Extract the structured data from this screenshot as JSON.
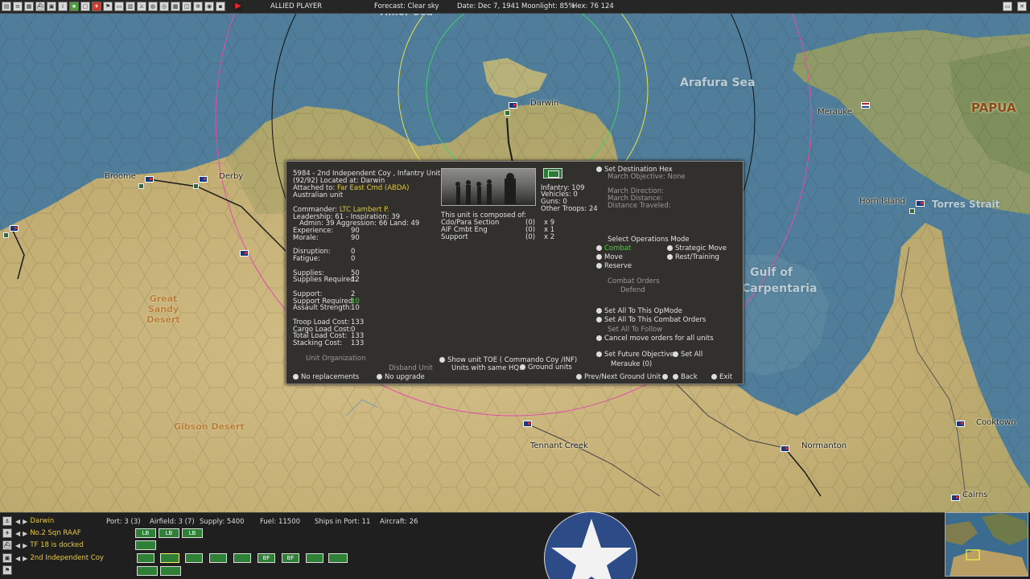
{
  "top_bar": {
    "side": "ALLIED PLAYER",
    "forecast": "Forecast: Clear sky",
    "date": "Date: Dec 7, 1941",
    "moonlight": "Moonlight: 85%",
    "hex": "Hex: 76 124",
    "icons": [
      "toolbar-button-1",
      "toolbar-button-2",
      "toolbar-button-3",
      "toolbar-button-4",
      "toolbar-button-5",
      "toolbar-button-6",
      "toolbar-button-7",
      "toolbar-button-8",
      "toolbar-button-9",
      "toolbar-button-10",
      "toolbar-button-11",
      "toolbar-button-12",
      "toolbar-button-13",
      "toolbar-button-14",
      "toolbar-button-15",
      "toolbar-button-16",
      "toolbar-button-17",
      "toolbar-button-18",
      "toolbar-button-19",
      "toolbar-button-20",
      "end-turn-play-icon"
    ]
  },
  "map": {
    "labels": {
      "darwin": "Darwin",
      "broome": "Broome",
      "derby": "Derby",
      "merauke": "Merauke",
      "horn_island": "Horn Island",
      "torres_strait": "Torres Strait",
      "arafura_sea": "Arafura Sea",
      "papua": "PAPUA",
      "tennant_creek": "Tennant Creek",
      "normanton": "Normanton",
      "cooktown": "Cooktown",
      "cairns": "Cairns",
      "gibson_desert": "Gibson Desert",
      "great_sandy_desert": "Great Sandy Desert",
      "gulf_of_carpentaria_1": "Gulf of",
      "gulf_of_carpentaria_2": "Carpentaria",
      "timor_sea_fragment": "Timor Sea"
    }
  },
  "unit_panel": {
    "title": "5984 - 2nd Independent Coy , Infantry Unit",
    "strength_location": "(92/92) Located at: Darwin",
    "attached_label": "Attached to:",
    "attached_value": "Far East Cmd (ABDA)",
    "nationality": "Australian unit",
    "commander_label": "Commander:",
    "commander_value": "LTC Lambert P.",
    "leadership": "Leadership: 61 - Inspiration: 39",
    "admin": "Admin: 39  Aggression: 66 Land: 49",
    "stats": [
      {
        "label": "Experience:",
        "value": "90"
      },
      {
        "label": "Morale:",
        "value": "90"
      },
      {
        "label": "Disruption:",
        "value": "0"
      },
      {
        "label": "Fatigue:",
        "value": "0"
      },
      {
        "label": "Supplies:",
        "value": "50"
      },
      {
        "label": "Supplies Required:",
        "value": "12"
      },
      {
        "label": "Support:",
        "value": "2"
      },
      {
        "label": "Support Required:",
        "value": "10"
      },
      {
        "label": "Assault Strength:",
        "value": "10"
      },
      {
        "label": "Troop Load Cost:",
        "value": "133"
      },
      {
        "label": "Cargo Load Cost:",
        "value": "0"
      },
      {
        "label": "Total Load Cost:",
        "value": "133"
      },
      {
        "label": "Stacking Cost:",
        "value": "133"
      }
    ],
    "unit_org": "Unit Organization",
    "disband": "Disband Unit",
    "no_replacements": "No replacements",
    "no_upgrade": "No upgrade",
    "composition": {
      "infantry": "Infantry: 109",
      "vehicles": "Vehicles: 0",
      "guns": "Guns: 0",
      "other": "Other Troops: 24",
      "header": "This unit is composed of:",
      "rows": [
        {
          "name": "Cdo/Para Section",
          "p": "(0)",
          "count": "x 9"
        },
        {
          "name": "AIF Cmbt Eng",
          "p": "(0)",
          "count": "x 1"
        },
        {
          "name": "Support",
          "p": "(0)",
          "count": "x 2"
        }
      ]
    },
    "show_toe": "Show unit TOE ( Commando Coy /INF)",
    "same_hq": "Units with same HQ:",
    "ground_units": "Ground units",
    "set_destination": "Set Destination Hex",
    "march_objective": "March Objective: None",
    "march_direction": "March Direction:",
    "march_distance": "March Distance:",
    "distance_traveled": "Distance Traveled:",
    "select_opmode": "Select Operations Mode",
    "combat": "Combat",
    "move": "Move",
    "reserve": "Reserve",
    "strategic_move": "Strategic Move",
    "rest_training": "Rest/Training",
    "combat_orders": "Combat Orders",
    "defend": "Defend",
    "set_all_opmode": "Set All To This OpMode",
    "set_all_combat": "Set All To This Combat Orders",
    "set_all_follow": "Set All To Follow",
    "cancel_move": "Cancel move orders for all units",
    "future_objective": "Set Future Objective",
    "set_all": "Set All",
    "merauke_obj": "Merauke (0)",
    "prev_next": "Prev/Next Ground Unit",
    "back": "Back",
    "exit": "Exit"
  },
  "bottom_bar": {
    "rows": [
      {
        "name": "Darwin",
        "icon": "base-icon"
      },
      {
        "name": "No.2 Sqn RAAF",
        "icon": "air-unit-icon"
      },
      {
        "name": "TF 18 is docked",
        "icon": "task-force-icon"
      },
      {
        "name": "2nd Independent Coy",
        "icon": "ground-unit-icon"
      }
    ],
    "port": "Port: 3 (3)",
    "airfield": "Airfield: 3 (7)",
    "supply": "Supply: 5400",
    "fuel": "Fuel: 11500",
    "ships_in_port": "Ships in Port: 11",
    "aircraft": "Aircraft: 26",
    "chips": [
      "LB",
      "LB",
      "LB",
      "",
      "",
      "",
      "",
      "",
      "",
      "BF",
      "BF",
      "",
      ""
    ]
  },
  "colors": {
    "panel_bg": "#31302c",
    "highlight_yellow": "#e0c83c",
    "highlight_green": "#46d046"
  }
}
